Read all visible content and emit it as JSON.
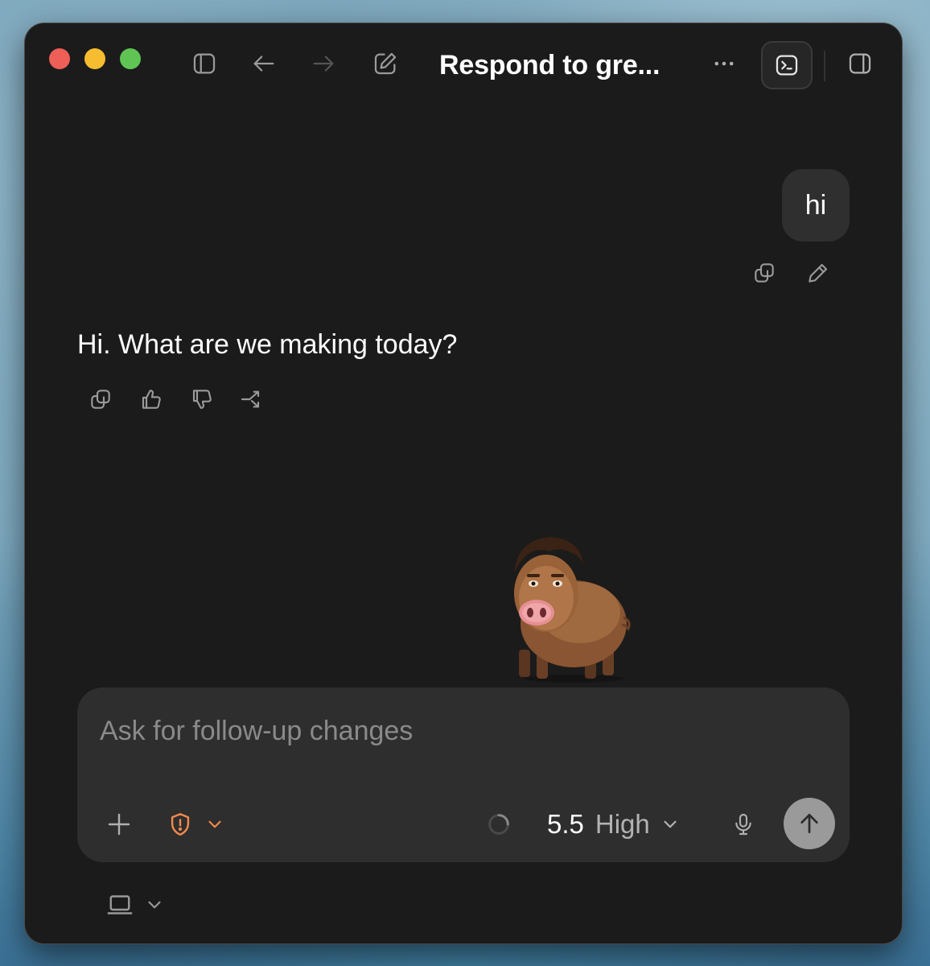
{
  "window": {
    "title": "Respond to gre..."
  },
  "conversation": {
    "user_message": "hi",
    "assistant_message": "Hi. What are we making today?"
  },
  "composer": {
    "placeholder": "Ask for follow-up changes",
    "model_version": "5.5",
    "model_level": "High"
  },
  "icons": {
    "sidebar_toggle": "sidebar-icon",
    "back": "arrow-left-icon",
    "forward": "arrow-right-icon",
    "new_chat": "compose-icon",
    "more": "ellipsis-icon",
    "terminal": "terminal-icon",
    "right_panel": "right-panel-icon",
    "copy": "copy-icon",
    "edit": "pencil-icon",
    "thumbs_up": "thumbs-up-icon",
    "thumbs_down": "thumbs-down-icon",
    "branch": "branch-icon",
    "add": "plus-icon",
    "permissions": "shield-alert-icon",
    "loading": "spinner-icon",
    "microphone": "microphone-icon",
    "send": "arrow-up-icon",
    "environment": "laptop-icon"
  },
  "colors": {
    "window_bg": "#1b1b1b",
    "bubble_bg": "#2f2f2f",
    "composer_bg": "#2e2e2e",
    "accent_orange": "#f08a4b",
    "send_button": "#9a9a9a"
  }
}
